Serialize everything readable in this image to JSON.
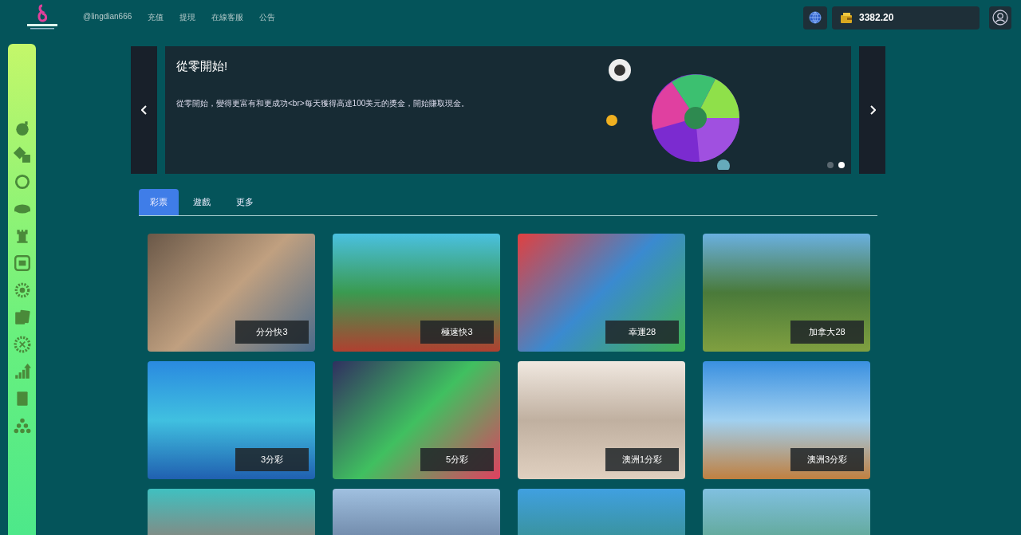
{
  "header": {
    "username": "@lingdian666",
    "nav": [
      "充值",
      "提現",
      "在線客服",
      "公告"
    ],
    "balance": "3382.20"
  },
  "banner": {
    "title": "從零開始!",
    "text": "從零開始，變得更富有和更成功<br>每天獲得高達100美元的獎金，開始賺取現金。",
    "dots": [
      {
        "selected": false
      },
      {
        "selected": true
      }
    ]
  },
  "tabs": [
    {
      "label": "彩票",
      "selected": true
    },
    {
      "label": "遊戲",
      "selected": false
    },
    {
      "label": "更多",
      "selected": false
    }
  ],
  "games": [
    {
      "label": "分分快3"
    },
    {
      "label": "極速快3"
    },
    {
      "label": "幸運28"
    },
    {
      "label": "加拿大28"
    },
    {
      "label": "3分彩"
    },
    {
      "label": "5分彩"
    },
    {
      "label": "澳洲1分彩"
    },
    {
      "label": "澳洲3分彩"
    },
    {
      "kind": "untitled"
    },
    {
      "kind": "untitled"
    },
    {
      "kind": "untitled"
    },
    {
      "kind": "untitled"
    }
  ]
}
